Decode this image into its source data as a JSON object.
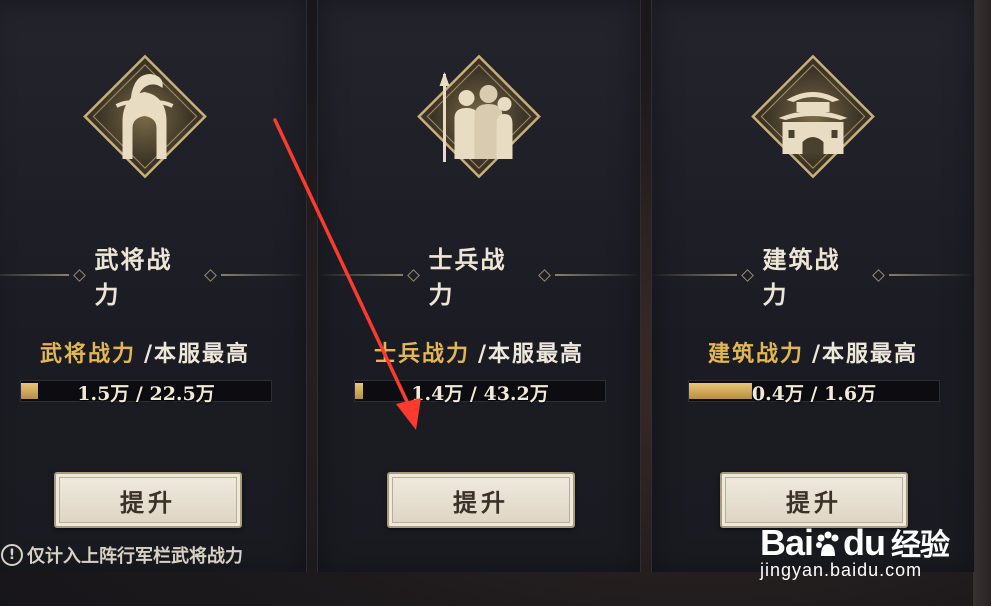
{
  "panels": [
    {
      "title": "武将战力",
      "icon": "general-helmet-icon",
      "stat_label": "武将战力",
      "stat_suffix": "/本服最高",
      "current": "1.5万",
      "server_max": "22.5万",
      "progress_fraction": 0.067,
      "button_label": "提升"
    },
    {
      "title": "士兵战力",
      "icon": "soldiers-icon",
      "stat_label": "士兵战力",
      "stat_suffix": "/本服最高",
      "current": "1.4万",
      "server_max": "43.2万",
      "progress_fraction": 0.032,
      "button_label": "提升"
    },
    {
      "title": "建筑战力",
      "icon": "city-gate-icon",
      "stat_label": "建筑战力",
      "stat_suffix": "/本服最高",
      "current": "0.4万",
      "server_max": "1.6万",
      "progress_fraction": 0.25,
      "button_label": "提升"
    }
  ],
  "note": "仅计入上阵行军栏武将战力",
  "watermark": {
    "brand_left": "Bai",
    "brand_right": "du",
    "brand_cn": "经验",
    "url": "jingyan.baidu.com"
  },
  "colors": {
    "gold": "#e2b653",
    "panel_bg": "#1d1e25",
    "button_bg": "#ece6d8",
    "arrow": "#ff3b30"
  }
}
